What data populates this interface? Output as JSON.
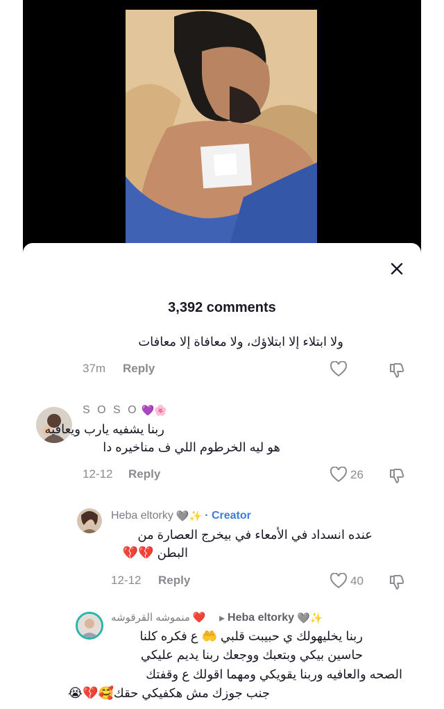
{
  "header": {
    "comment_count": "3,392 comments"
  },
  "comments": [
    {
      "text": "ولا ابتلاء إلا ابتلاؤك، ولا معافاة إلا معافات",
      "time": "37m",
      "reply_label": "Reply"
    },
    {
      "username": "S O S O",
      "username_emoji": "💜🌸",
      "text_line1": "ربنا يشفيه يارب ويعافيه",
      "text_line2": "هو ليه الخرطوم اللي ف مناخيره دا",
      "time": "12-12",
      "reply_label": "Reply",
      "likes": "26"
    },
    {
      "username": "Heba eltorky",
      "username_emoji": "🩶✨",
      "creator_label": "· Creator",
      "text_line1": "عنده انسداد في الأمعاء في بيخرج العصارة من",
      "text_line2": "البطن 💔💔",
      "time": "12-12",
      "reply_label": "Reply",
      "likes": "40"
    },
    {
      "username": "منموشه القرقوشه",
      "username_emoji": "❤️",
      "reply_arrow": "▸",
      "reply_to": "Heba eltorky",
      "reply_to_emoji": "🩶✨",
      "text_line1": "ربنا يخليهولك ي حبيبت قلبي 🤲 ع فكره كلنا",
      "text_line2": "حاسين بيكي وبتعبك ووجعك ربنا يديم عليكي",
      "text_line3": "الصحه والعافيه وربنا يقويكي ومهما اقولك ع وقفتك",
      "text_line4": "جنب جوزك مش هكفيكي حقك🥰💔😭"
    }
  ],
  "icons": {
    "close": "close-icon",
    "like": "heart-outline-icon",
    "dislike": "thumbs-down-icon"
  }
}
